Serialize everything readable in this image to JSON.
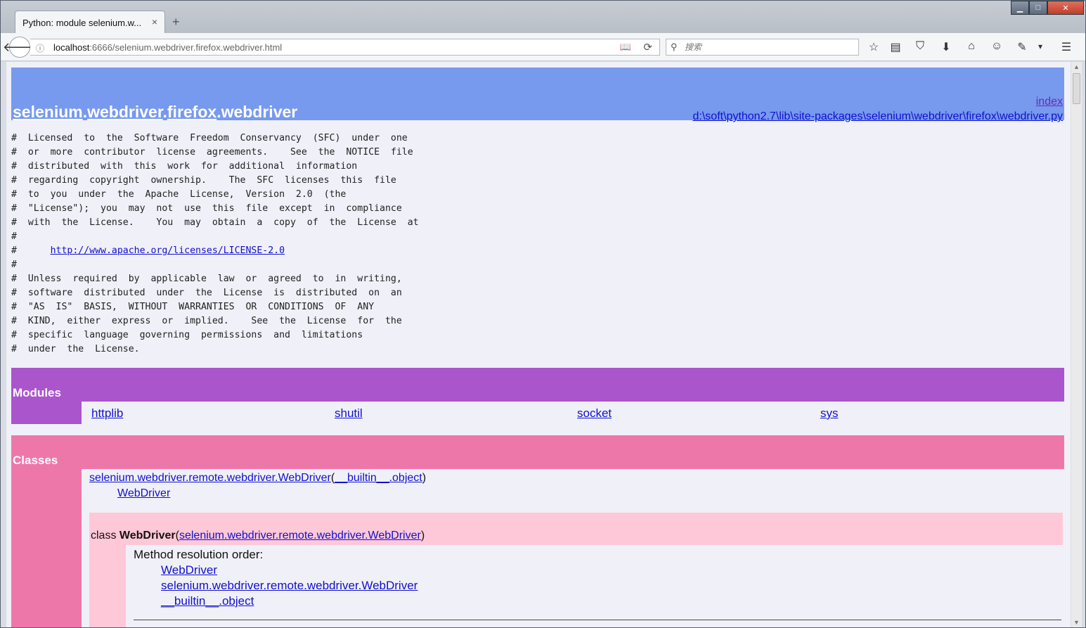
{
  "browser": {
    "tab_title": "Python: module selenium.w...",
    "tab_close": "×",
    "new_tab": "+",
    "win_min": "▁",
    "win_max": "□",
    "win_close": "✕",
    "url_host": "localhost",
    "url_path": ":6666/selenium.webdriver.firefox.webdriver.html",
    "search_placeholder": "搜索",
    "icons": {
      "back": "🡐",
      "info": "ⓘ",
      "reader": "📖",
      "reload": "⟳",
      "search": "⚲",
      "bookmark_star": "☆",
      "bookmarks_list": "▤",
      "pocket": "⛉",
      "download": "⬇",
      "home": "⌂",
      "chat": "☺",
      "extension": "✎",
      "overflow": "▾",
      "menu": "☰"
    }
  },
  "page": {
    "heading": {
      "title_parts": [
        "selenium",
        "webdriver",
        "firefox"
      ],
      "title_sep": ".",
      "title_last": "webdriver",
      "index_link": "index",
      "file_link": "d:\\soft\\python2.7\\lib\\site-packages\\selenium\\webdriver\\firefox\\webdriver.py"
    },
    "comments": [
      "#  Licensed  to  the  Software  Freedom  Conservancy  (SFC)  under  one",
      "#  or  more  contributor  license  agreements.    See  the  NOTICE  file",
      "#  distributed  with  this  work  for  additional  information",
      "#  regarding  copyright  ownership.    The  SFC  licenses  this  file",
      "#  to  you  under  the  Apache  License,  Version  2.0  (the",
      "#  \"License\");  you  may  not  use  this  file  except  in  compliance",
      "#  with  the  License.    You  may  obtain  a  copy  of  the  License  at",
      "#"
    ],
    "comment_link_prefix": "#      ",
    "comment_link": "http://www.apache.org/licenses/LICENSE-2.0",
    "comments_after": [
      "#",
      "#  Unless  required  by  applicable  law  or  agreed  to  in  writing,",
      "#  software  distributed  under  the  License  is  distributed  on  an",
      "#  \"AS  IS\"  BASIS,  WITHOUT  WARRANTIES  OR  CONDITIONS  OF  ANY",
      "#  KIND,  either  express  or  implied.    See  the  License  for  the",
      "#  specific  language  governing  permissions  and  limitations",
      "#  under  the  License."
    ],
    "modules": {
      "title": "Modules",
      "items": [
        "httplib",
        "shutil",
        "socket",
        "sys"
      ]
    },
    "classes": {
      "title": "Classes",
      "tree_parent": "selenium.webdriver.remote.webdriver.WebDriver",
      "tree_paren_open": "(",
      "tree_base": "__builtin__.object",
      "tree_paren_close": ")",
      "tree_child": "WebDriver",
      "class_keyword": "class ",
      "class_name": "WebDriver",
      "class_base": "selenium.webdriver.remote.webdriver.WebDriver",
      "mro_title": "Method resolution order:",
      "mro": [
        "WebDriver",
        "selenium.webdriver.remote.webdriver.WebDriver",
        "__builtin__.object"
      ]
    }
  }
}
